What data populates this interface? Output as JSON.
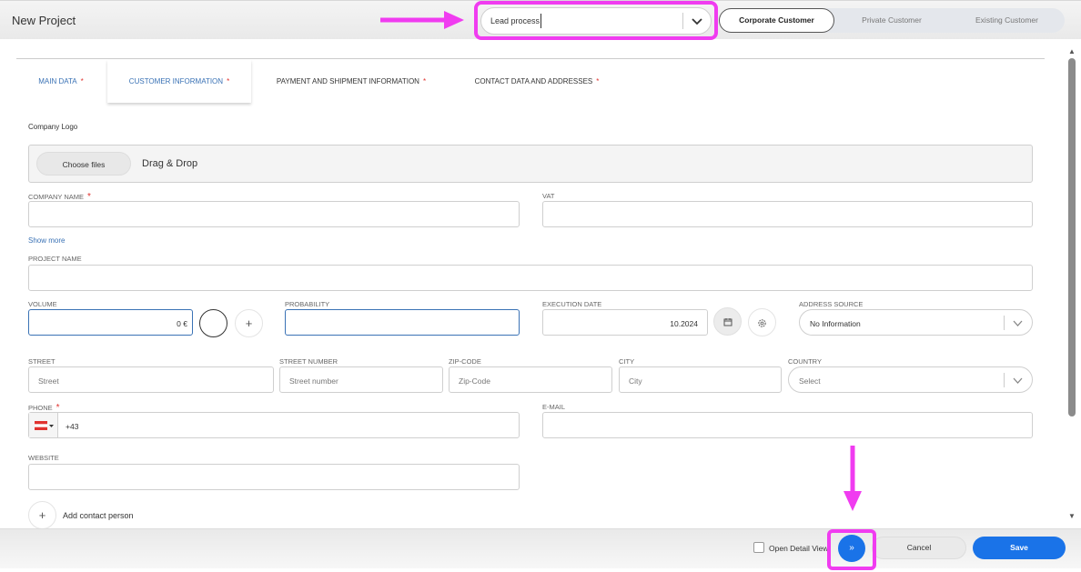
{
  "header": {
    "title": "New Project",
    "process_value": "Lead process",
    "customer_types": [
      {
        "label": "Corporate Customer",
        "active": true
      },
      {
        "label": "Private Customer",
        "active": false
      },
      {
        "label": "Existing Customer",
        "active": false
      }
    ]
  },
  "tabs": [
    {
      "label": "MAIN DATA",
      "required": "*"
    },
    {
      "label": "CUSTOMER INFORMATION",
      "required": "*"
    },
    {
      "label": "PAYMENT AND SHIPMENT INFORMATION",
      "required": "*"
    },
    {
      "label": "CONTACT DATA AND ADDRESSES",
      "required": "*"
    }
  ],
  "form": {
    "company_logo_label": "Company Logo",
    "choose_files": "Choose files",
    "drag_drop": "Drag & Drop",
    "company_name_label": "COMPANY NAME",
    "required_mark": "*",
    "vat_label": "VAT",
    "show_more": "Show more",
    "project_name_label": "PROJECT NAME",
    "volume_label": "VOLUME",
    "volume_value": "0 €",
    "add_symbol": "+",
    "probability_label": "PROBABILITY",
    "execution_date_label": "EXECUTION DATE",
    "execution_date_value": "10.2024",
    "address_source_label": "ADDRESS SOURCE",
    "address_source_value": "No Information",
    "street_label": "STREET",
    "street_placeholder": "Street",
    "street_number_label": "STREET NUMBER",
    "street_number_placeholder": "Street number",
    "zip_label": "ZIP-CODE",
    "zip_placeholder": "Zip-Code",
    "city_label": "CITY",
    "city_placeholder": "City",
    "country_label": "COUNTRY",
    "country_value": "Select",
    "phone_label": "PHONE",
    "phone_prefix": "+43",
    "email_label": "E-MAIL",
    "website_label": "WEBSITE",
    "add_contact_person": "Add contact person"
  },
  "footer": {
    "open_detail_view": "Open Detail View",
    "next_symbol": "»",
    "cancel": "Cancel",
    "save": "Save"
  },
  "colors": {
    "accent": "#1a73e8",
    "highlight": "#f03cf0",
    "required": "#e0332f",
    "link": "#3a72b5"
  }
}
